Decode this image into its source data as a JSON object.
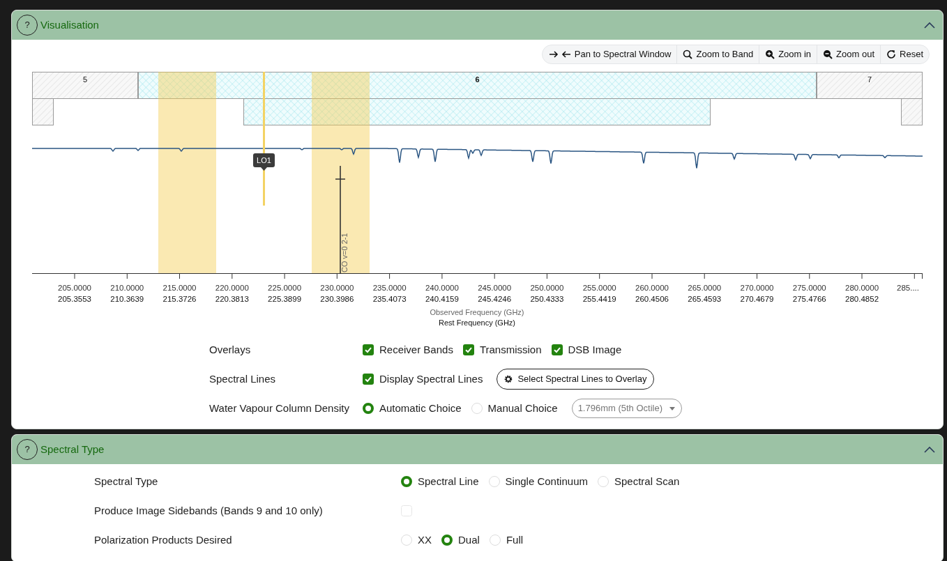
{
  "visualisation": {
    "title": "Visualisation",
    "help": "?",
    "expanded": true,
    "toolbar": [
      {
        "kind": "pan",
        "label": "Pan to Spectral Window"
      },
      {
        "kind": "search",
        "label": "Zoom to Band"
      },
      {
        "kind": "zoom_in",
        "label": "Zoom in"
      },
      {
        "kind": "zoom_out",
        "label": "Zoom out"
      },
      {
        "kind": "reset",
        "label": "Reset"
      }
    ],
    "plot": {
      "bands": [
        {
          "label": "5",
          "selected": false
        },
        {
          "label": "6",
          "selected": true
        },
        {
          "label": "7",
          "selected": false
        }
      ],
      "lo_marker": "LO1",
      "spectral_line": "CO v=0 2-1",
      "observed_ticks": [
        "205.0000",
        "210.0000",
        "215.0000",
        "220.0000",
        "225.0000",
        "230.0000",
        "235.0000",
        "240.0000",
        "245.0000",
        "250.0000",
        "255.0000",
        "260.0000",
        "265.0000",
        "270.0000",
        "275.0000",
        "280.0000",
        "285...."
      ],
      "rest_ticks": [
        "205.3553",
        "210.3639",
        "215.3726",
        "220.3813",
        "225.3899",
        "230.3986",
        "235.4073",
        "240.4159",
        "245.4246",
        "250.4333",
        "255.4419",
        "260.4506",
        "265.4593",
        "270.4679",
        "275.4766",
        "280.4852"
      ],
      "observed_label": "Observed Frequency (GHz)",
      "rest_label": "Rest Frequency (GHz)"
    },
    "options": [
      {
        "label": "Overlays",
        "controls": [
          {
            "kind": "checkbox",
            "label": "Receiver Bands",
            "checked": true
          },
          {
            "kind": "checkbox",
            "label": "Transmission",
            "checked": true
          },
          {
            "kind": "checkbox",
            "label": "DSB Image",
            "checked": true
          }
        ]
      },
      {
        "label": "Spectral Lines",
        "controls": [
          {
            "kind": "checkbox",
            "label": "Display Spectral Lines",
            "checked": true
          },
          {
            "kind": "button",
            "label": "Select Spectral Lines to Overlay"
          }
        ]
      },
      {
        "label": "Water Vapour Column Density",
        "controls": [
          {
            "kind": "radio",
            "label": "Automatic Choice",
            "selected": true
          },
          {
            "kind": "radio",
            "label": "Manual Choice",
            "selected": false
          },
          {
            "kind": "dropdown",
            "value": "1.796mm (5th Octile)",
            "disabled": true
          }
        ]
      }
    ]
  },
  "spectral_type": {
    "title": "Spectral Type",
    "help": "?",
    "expanded": true,
    "options": [
      {
        "label": "Spectral Type",
        "controls": [
          {
            "kind": "radio",
            "label": "Spectral Line",
            "selected": true
          },
          {
            "kind": "radio",
            "label": "Single Continuum",
            "selected": false
          },
          {
            "kind": "radio",
            "label": "Spectral Scan",
            "selected": false
          }
        ]
      },
      {
        "label": "Produce Image Sidebands (Bands 9 and 10 only)",
        "controls": [
          {
            "kind": "checkbox",
            "checked": false,
            "disabled": true
          }
        ]
      },
      {
        "label": "Polarization Products Desired",
        "controls": [
          {
            "kind": "radio",
            "label": "XX",
            "selected": false
          },
          {
            "kind": "radio",
            "label": "Dual",
            "selected": true
          },
          {
            "kind": "radio",
            "label": "Full",
            "selected": false
          }
        ]
      }
    ]
  }
}
